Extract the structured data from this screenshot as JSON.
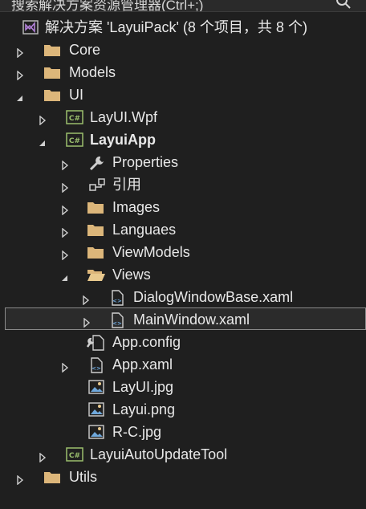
{
  "search": {
    "text": "搜索解决方案资源管理器(Ctrl+;)"
  },
  "tree": [
    {
      "label": "解决方案 'LayuiPack' (8 个项目，共 8 个)",
      "icon": "solution-icon",
      "expander": "none",
      "name": "solution-root"
    },
    {
      "label": "Core",
      "icon": "folder-icon",
      "expander": "collapsed",
      "name": "folder-core"
    },
    {
      "label": "Models",
      "icon": "folder-icon",
      "expander": "collapsed",
      "name": "folder-models"
    },
    {
      "label": "UI",
      "icon": "folder-icon",
      "expander": "expanded",
      "name": "folder-ui"
    },
    {
      "label": "LayUI.Wpf",
      "icon": "csharp-project-icon",
      "expander": "collapsed",
      "name": "project-layui-wpf"
    },
    {
      "label": "LayuiApp",
      "icon": "csharp-project-icon",
      "expander": "expanded",
      "bold": true,
      "name": "project-layuiapp"
    },
    {
      "label": "Properties",
      "icon": "wrench-icon",
      "expander": "collapsed",
      "name": "properties-node"
    },
    {
      "label": "引用",
      "icon": "references-icon",
      "expander": "collapsed",
      "name": "references-node"
    },
    {
      "label": "Images",
      "icon": "folder-icon",
      "expander": "collapsed",
      "name": "folder-images"
    },
    {
      "label": "Languaes",
      "icon": "folder-icon",
      "expander": "collapsed",
      "name": "folder-languaes"
    },
    {
      "label": "ViewModels",
      "icon": "folder-icon",
      "expander": "collapsed",
      "name": "folder-viewmodels"
    },
    {
      "label": "Views",
      "icon": "folder-open-icon",
      "expander": "expanded",
      "name": "folder-views"
    },
    {
      "label": "DialogWindowBase.xaml",
      "icon": "xaml-file-icon",
      "expander": "collapsed",
      "name": "file-dialogwindowbase"
    },
    {
      "label": "MainWindow.xaml",
      "icon": "xaml-file-icon",
      "expander": "collapsed",
      "selected": true,
      "name": "file-mainwindow"
    },
    {
      "label": "App.config",
      "icon": "config-file-icon",
      "expander": "none",
      "name": "file-app-config"
    },
    {
      "label": "App.xaml",
      "icon": "xaml-file-icon",
      "expander": "collapsed",
      "name": "file-app-xaml"
    },
    {
      "label": "LayUI.jpg",
      "icon": "image-file-icon",
      "expander": "none",
      "name": "file-layui-jpg"
    },
    {
      "label": "Layui.png",
      "icon": "image-file-icon",
      "expander": "none",
      "name": "file-layui-png"
    },
    {
      "label": "R-C.jpg",
      "icon": "image-file-icon",
      "expander": "none",
      "name": "file-rc-jpg"
    },
    {
      "label": "LayuiAutoUpdateTool",
      "icon": "csharp-project-icon",
      "expander": "collapsed",
      "name": "project-autoupdatetool"
    },
    {
      "label": "Utils",
      "icon": "folder-icon",
      "expander": "collapsed",
      "name": "folder-utils"
    }
  ]
}
